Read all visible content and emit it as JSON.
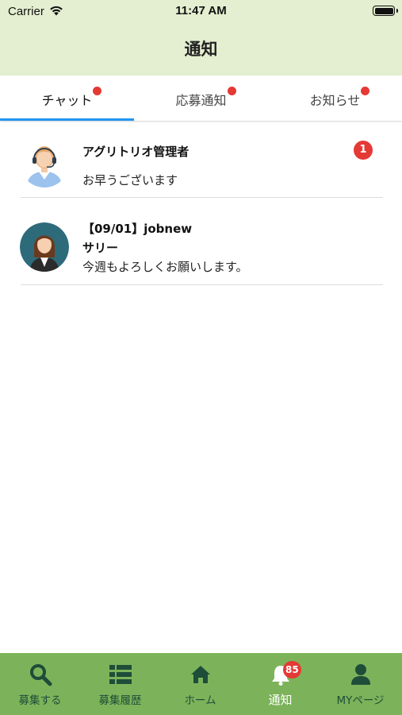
{
  "status": {
    "carrier": "Carrier",
    "time": "11:47 AM",
    "battery_level": 1.0
  },
  "header": {
    "title": "通知"
  },
  "tabs": [
    {
      "label": "チャット",
      "active": true,
      "has_dot": true
    },
    {
      "label": "応募通知",
      "active": false,
      "has_dot": true
    },
    {
      "label": "お知らせ",
      "active": false,
      "has_dot": true
    }
  ],
  "chats": [
    {
      "title": "アグリトリオ管理者",
      "subtitle": "",
      "message": "お早うございます",
      "unread": "1",
      "avatar": "support-agent-avatar"
    },
    {
      "title": "【09/01】jobnew",
      "subtitle": "サリー",
      "message": "今週もよろしくお願いします。",
      "unread": "",
      "avatar": "woman-avatar"
    }
  ],
  "bottom_nav": [
    {
      "label": "募集する",
      "icon": "search-icon",
      "active": false
    },
    {
      "label": "募集履歴",
      "icon": "list-icon",
      "active": false
    },
    {
      "label": "ホーム",
      "icon": "home-icon",
      "active": false
    },
    {
      "label": "通知",
      "icon": "bell-icon",
      "active": true,
      "badge": "85"
    },
    {
      "label": "MYページ",
      "icon": "user-icon",
      "active": false
    }
  ],
  "colors": {
    "header_bg": "#e3efd0",
    "nav_bg": "#7cb35a",
    "nav_icon": "#1e4d39",
    "tab_underline": "#2196f3",
    "badge": "#e53935"
  }
}
